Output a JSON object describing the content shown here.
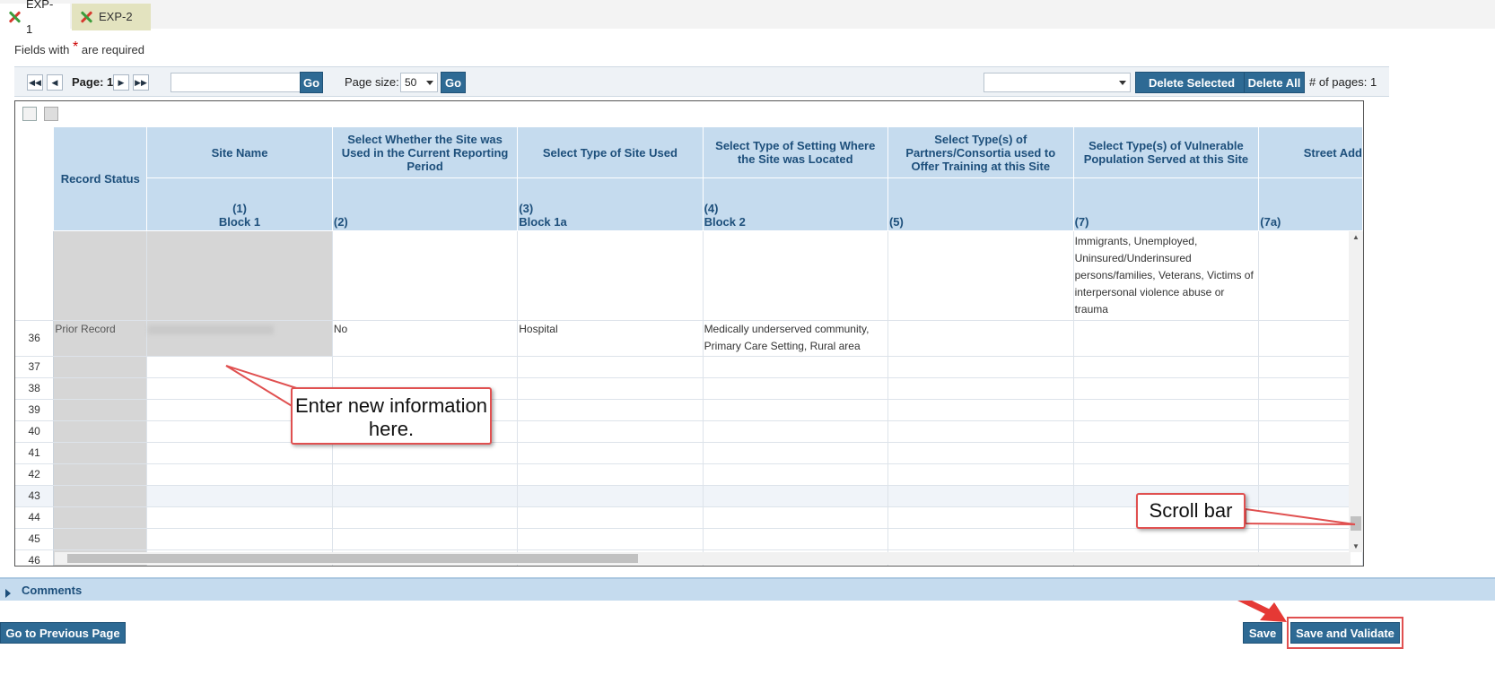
{
  "tabs": [
    {
      "label": "EXP-1",
      "active": true
    },
    {
      "label": "EXP-2",
      "active": false
    }
  ],
  "required_note": {
    "prefix": "Fields with",
    "star": "*",
    "suffix": "are required"
  },
  "pager": {
    "first_icon": "first-page-icon",
    "prev_icon": "prev-page-icon",
    "next_icon": "next-page-icon",
    "last_icon": "last-page-icon",
    "page_label": "Page: 1",
    "page_input_value": "",
    "go_label": "Go",
    "page_size_label": "Page size:",
    "page_size_value": "50",
    "go2_label": "Go",
    "action_select_value": "",
    "delete_selected_label": "Delete Selected",
    "delete_all_label": "Delete All",
    "num_pages_label": "# of pages: 1"
  },
  "grid": {
    "tool_icons": [
      "copy-icon",
      "paste-icon"
    ],
    "headers": {
      "record_status": "Record Status",
      "site_name": "Site Name",
      "site_used": "Select Whether the Site was Used in the Current Reporting Period",
      "site_type": "Select Type of Site Used",
      "setting_type": "Select Type of Setting Where the Site was Located",
      "partners": "Select Type(s) of Partners/Consortia used to Offer Training at this Site",
      "vulnerable": "Select Type(s) of Vulnerable Population Served at this Site",
      "street": "Street Add"
    },
    "subheaders": {
      "site_name_num": "(1)",
      "site_name_block": "Block 1",
      "site_used_num": "(2)",
      "site_type_num": "(3)",
      "site_type_block": "Block 1a",
      "setting_num": "(4)",
      "setting_block": "Block 2",
      "partners_num": "(5)",
      "vulnerable_num": "(7)",
      "street_num": "(7a)"
    },
    "partial_row_text": "Immigrants, Unemployed, Uninsured/Underinsured persons/families, Veterans, Victims of interpersonal violence abuse or trauma",
    "row36": {
      "num": "36",
      "status": "Prior Record",
      "site_used": "No",
      "site_type": "Hospital",
      "setting": "Medically underserved community, Primary Care Setting, Rural area"
    },
    "empty_rows": [
      "37",
      "38",
      "39",
      "40",
      "41",
      "42",
      "43",
      "44",
      "45",
      "46"
    ]
  },
  "callouts": {
    "enter_info": "Enter new information here.",
    "scroll_bar": "Scroll bar"
  },
  "comments": {
    "label": "Comments"
  },
  "footer": {
    "prev_page_label": "Go to Previous Page",
    "save_label": "Save",
    "save_validate_label": "Save and Validate"
  },
  "colors": {
    "header_bg": "#c5dbee",
    "header_text": "#1d4f7b",
    "button_bg": "#2e6a94",
    "callout_border": "#e05050"
  }
}
